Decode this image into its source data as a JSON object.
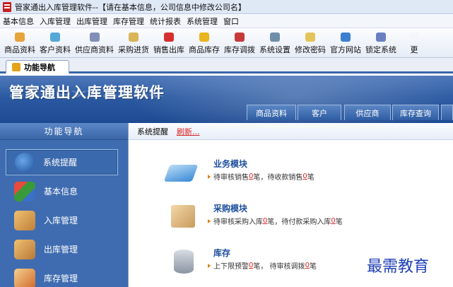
{
  "window": {
    "title": "管家通出入库管理软件--【请在基本信息，公司信息中修改公司名】"
  },
  "menu": [
    "基本信息",
    "入库管理",
    "出库管理",
    "库存管理",
    "统计报表",
    "系统管理",
    "窗口"
  ],
  "toolbar": [
    {
      "label": "商品资料",
      "icon": "goods-icon",
      "color": "#e7a43a"
    },
    {
      "label": "客户资料",
      "icon": "customer-icon",
      "color": "#56a8d8"
    },
    {
      "label": "供应商资料",
      "icon": "supplier-icon",
      "color": "#7f8fb8"
    },
    {
      "label": "采购进货",
      "icon": "purchase-icon",
      "color": "#d9b458"
    },
    {
      "label": "销售出库",
      "icon": "sales-icon",
      "color": "#d43030"
    },
    {
      "label": "商品库存",
      "icon": "inventory-icon",
      "color": "#e9b51e"
    },
    {
      "label": "库存调拨",
      "icon": "transfer-icon",
      "color": "#c83a3a"
    },
    {
      "label": "系统设置",
      "icon": "settings-icon",
      "color": "#6f8fa9"
    },
    {
      "label": "修改密码",
      "icon": "password-icon",
      "color": "#e2c55a"
    },
    {
      "label": "官方网站",
      "icon": "website-icon",
      "color": "#3a80d0"
    },
    {
      "label": "锁定系统",
      "icon": "lock-icon",
      "color": "#6a7fc2"
    },
    {
      "label": "更",
      "icon": "more-icon",
      "color": "#f3f6fb"
    }
  ],
  "tab": {
    "label": "功能导航"
  },
  "banner": {
    "title": "管家通出入库管理软件",
    "tabs": [
      "商品资料",
      "客户",
      "供应商",
      "库存查询"
    ]
  },
  "sidebar": {
    "title": "功能导航",
    "items": [
      {
        "label": "系统提醒",
        "icon": "info-icon",
        "color": "#2a6fbf",
        "active": true
      },
      {
        "label": "基本信息",
        "icon": "cubes-icon",
        "color": "#d8462f"
      },
      {
        "label": "入库管理",
        "icon": "box-in-icon",
        "color": "#d89a3a"
      },
      {
        "label": "出库管理",
        "icon": "box-out-icon",
        "color": "#d89a3a"
      },
      {
        "label": "库存管理",
        "icon": "warehouse-icon",
        "color": "#e08a3a"
      }
    ]
  },
  "breadcrumb": {
    "current": "系统提醒",
    "refresh": "刷新..."
  },
  "modules": [
    {
      "title": "业务模块",
      "icon": "book-icon",
      "prefix1": "待审核销售",
      "n1": "0",
      "mid": "笔，待收款销售",
      "n2": "0",
      "suffix": "笔"
    },
    {
      "title": "采购模块",
      "icon": "package-icon",
      "prefix1": "待审核采购入库",
      "n1": "0",
      "mid": "笔，待付款采购入库",
      "n2": "0",
      "suffix": "笔"
    },
    {
      "title": "库存",
      "icon": "database-icon",
      "prefix1": "上下限预警",
      "n1": "0",
      "mid": "笔，  待审核调拨",
      "n2": "0",
      "suffix": "笔"
    }
  ],
  "watermark": "最需教育"
}
